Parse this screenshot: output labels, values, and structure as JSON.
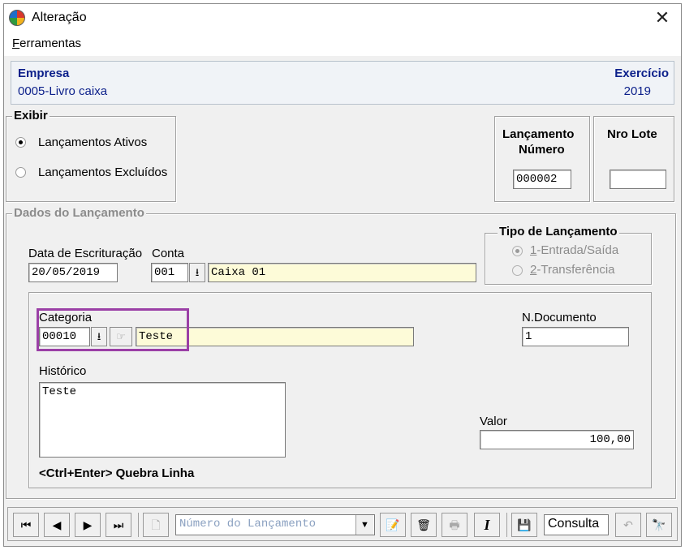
{
  "window": {
    "title": "Alteração",
    "close_glyph": "✕"
  },
  "menu": {
    "items": [
      {
        "label_underlined": "F",
        "label_rest": "erramentas"
      }
    ]
  },
  "company": {
    "empresa_label": "Empresa",
    "empresa_value": "0005-Livro caixa",
    "exercicio_label": "Exercício",
    "exercicio_value": "2019"
  },
  "exibir": {
    "legend": "Exibir",
    "options": [
      {
        "label": "Lançamentos Ativos",
        "checked": true
      },
      {
        "label": "Lançamentos Excluídos",
        "checked": false
      }
    ]
  },
  "lancamento": {
    "label_line1": "Lançamento",
    "label_line2": "Número",
    "value": "000002"
  },
  "lote": {
    "label": "Nro Lote",
    "value": ""
  },
  "dados": {
    "legend": "Dados do Lançamento",
    "data_escrituracao_label": "Data de Escrituração",
    "data_escrituracao_value": "20/05/2019",
    "conta_label": "Conta",
    "conta_code": "001",
    "conta_name": "Caixa 01",
    "tipo": {
      "legend": "Tipo de Lançamento",
      "options": [
        {
          "underlined": "1",
          "label": "-Entrada/Saída",
          "checked": true
        },
        {
          "underlined": "2",
          "label": "-Transferência",
          "checked": false
        }
      ]
    },
    "categoria_label": "Categoria",
    "categoria_code": "00010",
    "categoria_name": "Teste",
    "ndocumento_label": "N.Documento",
    "ndocumento_value": "1",
    "historico_label": "Histórico",
    "historico_value": "Teste",
    "valor_label": "Valor",
    "valor_value": "100,00",
    "hint": "<Ctrl+Enter> Quebra Linha"
  },
  "toolbar": {
    "first_icon": "first-record-icon",
    "prev_icon": "previous-record-icon",
    "next_icon": "next-record-icon",
    "last_icon": "last-record-icon",
    "search_placeholder": "Número do Lançamento",
    "mode_value": "Consulta"
  },
  "colors": {
    "accent_blue": "#0b1f8a",
    "highlight": "#9b3fa6",
    "input_yellow": "#fdfbd8"
  }
}
